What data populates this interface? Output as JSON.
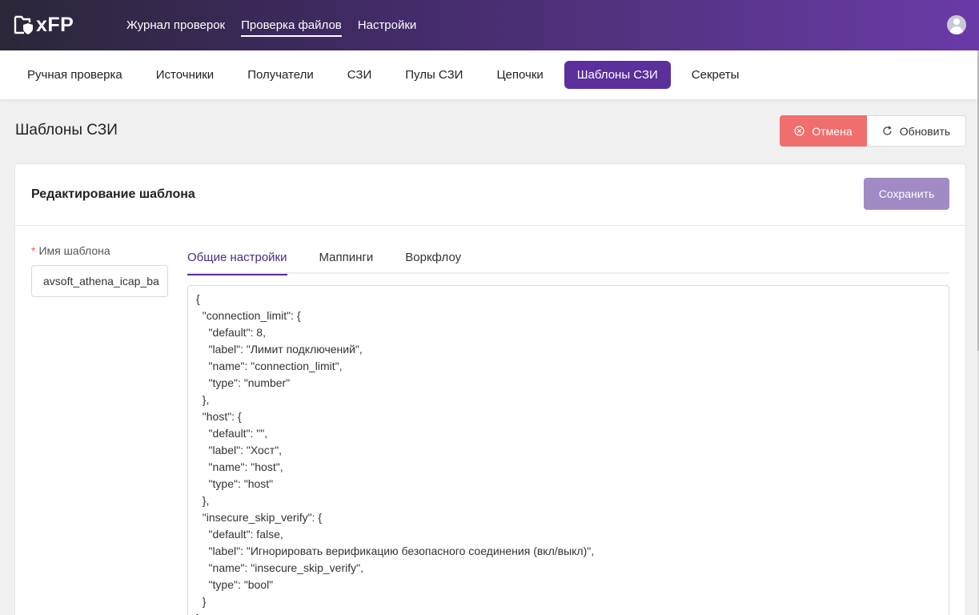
{
  "app": {
    "logo_text": "xFP"
  },
  "topnav": {
    "items": [
      "Журнал проверок",
      "Проверка файлов",
      "Настройки"
    ],
    "active_index": 1
  },
  "subnav": {
    "items": [
      "Ручная проверка",
      "Источники",
      "Получатели",
      "СЗИ",
      "Пулы СЗИ",
      "Цепочки",
      "Шаблоны СЗИ",
      "Секреты"
    ],
    "active_index": 6
  },
  "page": {
    "title": "Шаблоны СЗИ",
    "cancel_label": "Отмена",
    "refresh_label": "Обновить"
  },
  "card": {
    "title": "Редактирование шаблона",
    "save_label": "Сохранить",
    "name_field": {
      "label": "Имя шаблона",
      "required_mark": "*",
      "value": "avsoft_athena_icap_ba"
    },
    "tabs": [
      "Общие настройки",
      "Маппинги",
      "Воркфлоу"
    ],
    "active_tab": 0,
    "editor_content": "{\n  \"connection_limit\": {\n    \"default\": 8,\n    \"label\": \"Лимит подключений\",\n    \"name\": \"connection_limit\",\n    \"type\": \"number\"\n  },\n  \"host\": {\n    \"default\": \"\",\n    \"label\": \"Хост\",\n    \"name\": \"host\",\n    \"type\": \"host\"\n  },\n  \"insecure_skip_verify\": {\n    \"default\": false,\n    \"label\": \"Игнорировать верификацию безопасного соединения (вкл/выкл)\",\n    \"name\": \"insecure_skip_verify\",\n    \"type\": \"bool\"\n  }\n},"
  },
  "colors": {
    "header_gradient_start": "#2c2639",
    "header_gradient_end": "#6a3aa8",
    "accent": "#5b2f9c",
    "cancel": "#f06e6e",
    "save_disabled": "#a08bc4"
  },
  "icons": {
    "logo": "shield-folder-icon",
    "avatar": "user-avatar-icon",
    "cancel": "close-circle-icon",
    "refresh": "refresh-icon"
  }
}
